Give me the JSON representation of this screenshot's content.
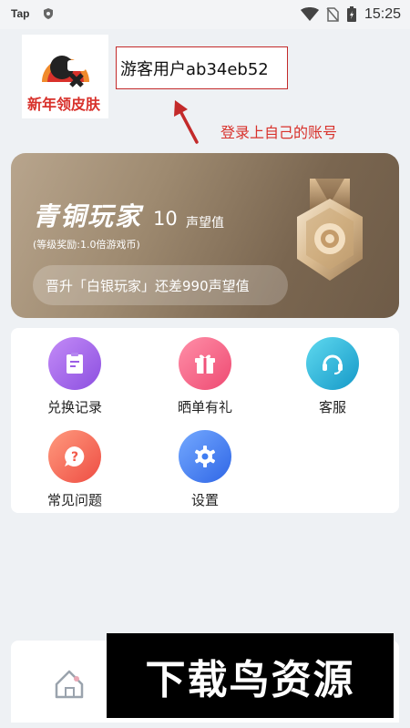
{
  "status_bar": {
    "app_label": "Tap",
    "time": "15:25"
  },
  "profile": {
    "avatar_text": "新年领皮肤",
    "username": "游客用户ab34eb52",
    "hint": "登录上自己的账号"
  },
  "level": {
    "name": "青铜玩家",
    "points": "10",
    "points_unit": "声望值",
    "reward": "(等级奖励:1.0倍游戏币)",
    "upgrade_text": "晋升「白银玩家」还差990声望值"
  },
  "menu": {
    "items": [
      {
        "label": "兑换记录",
        "icon": "clipboard-edit-icon",
        "color": "#9b5de5"
      },
      {
        "label": "晒单有礼",
        "icon": "gift-icon",
        "color": "#f0527a"
      },
      {
        "label": "客服",
        "icon": "headset-icon",
        "color": "#1fb5d6"
      },
      {
        "label": "常见问题",
        "icon": "question-bubble-icon",
        "color": "#f25a4a"
      },
      {
        "label": "设置",
        "icon": "gear-icon",
        "color": "#3f7df2"
      }
    ]
  },
  "watermark": "下载鸟资源",
  "colors": {
    "hint_red": "#d8312b",
    "card_gold": "#9e8a70",
    "background": "#eef1f4"
  }
}
